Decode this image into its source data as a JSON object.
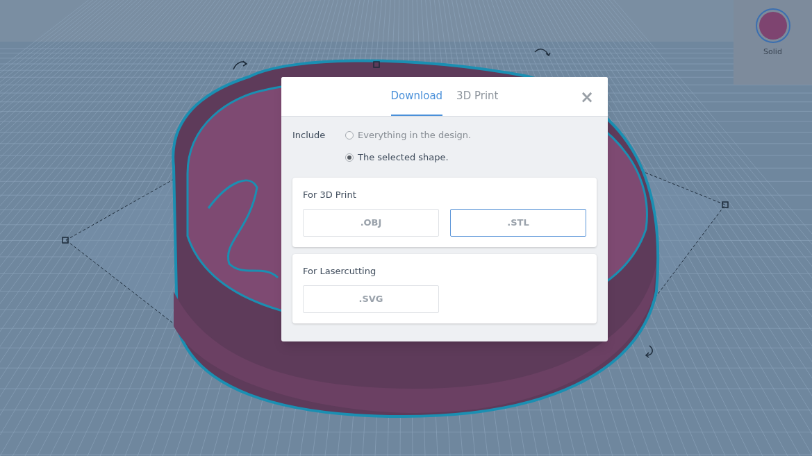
{
  "shape_panel": {
    "label": "Solid"
  },
  "dialog": {
    "tabs": [
      {
        "label": "Download",
        "selected": true
      },
      {
        "label": "3D Print",
        "selected": false
      }
    ],
    "close": "×",
    "include": {
      "label": "Include",
      "options": [
        {
          "label": "Everything in the design.",
          "selected": false
        },
        {
          "label": "The selected shape.",
          "selected": true
        }
      ]
    },
    "sections": [
      {
        "title": "For 3D Print",
        "formats": [
          {
            "label": ".OBJ",
            "selected": false
          },
          {
            "label": ".STL",
            "selected": true
          }
        ]
      },
      {
        "title": "For Lasercutting",
        "formats": [
          {
            "label": ".SVG",
            "selected": false
          }
        ]
      }
    ]
  }
}
